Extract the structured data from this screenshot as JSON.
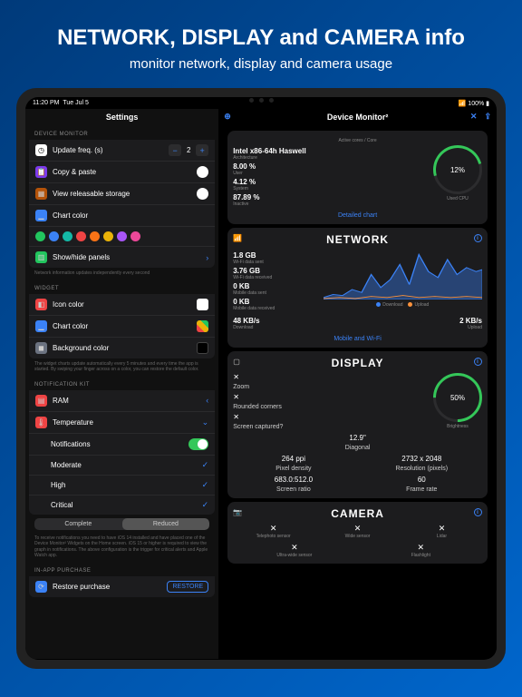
{
  "hero": {
    "title": "NETWORK, DISPLAY and CAMERA info",
    "subtitle": "monitor network, display and camera usage"
  },
  "status": {
    "time": "11:20 PM",
    "date": "Tue Jul 5",
    "battery": "100%"
  },
  "left": {
    "title": "Settings",
    "groups": {
      "device_monitor": "DEVICE MONITOR",
      "widget": "WIDGET",
      "notification_kit": "NOTIFICATION KIT",
      "iap": "IN-APP PURCHASE"
    },
    "rows": {
      "update_freq": "Update freq. (s)",
      "update_val": "2",
      "copy_paste": "Copy & paste",
      "view_storage": "View releasable storage",
      "chart_color": "Chart color",
      "show_hide": "Show/hide panels",
      "icon_color": "Icon color",
      "chart_color2": "Chart color",
      "bg_color": "Background color",
      "ram": "RAM",
      "temperature": "Temperature",
      "notifications": "Notifications",
      "moderate": "Moderate",
      "high": "High",
      "critical": "Critical",
      "complete": "Complete",
      "reduced": "Reduced",
      "restore": "Restore purchase",
      "restore_btn": "RESTORE"
    },
    "caption1": "Network information updates independently every second",
    "caption2": "The widget charts update automatically every 5 minutes and every time the app is started.\nBy swiping your finger across on a color, you can restore the default color.",
    "caption3": "To receive notifications you need to have iOS 14 installed and have placed one of the Device Monitor² Widgets on the Home screen.\niOS 15 or higher is required to view the graph in notifications.\nThe above configuration is the trigger for critical alerts and Apple Watch app."
  },
  "right": {
    "title": "Device Monitor²",
    "cpu": {
      "cores": "Active cores / Core",
      "chip": "Intel x86-64h Haswell",
      "chip_l": "Architecture",
      "user": "8.00 %",
      "user_l": "User",
      "system": "4.12 %",
      "system_l": "System",
      "inactive": "87.89 %",
      "inactive_l": "Inactive",
      "used": "12%",
      "used_l": "Used CPU",
      "link": "Detailed chart"
    },
    "network": {
      "title": "NETWORK",
      "sent": "1.8 GB",
      "sent_l": "Wi-Fi data sent",
      "recv": "3.76 GB",
      "recv_l": "Wi-Fi data received",
      "msent": "0 KB",
      "msent_l": "Mobile data sent",
      "mrecv": "0 KB",
      "mrecv_l": "Mobile data received",
      "down": "48 KB/s",
      "down_l": "Download",
      "up": "2 KB/s",
      "up_l": "Upload",
      "legend_dl": "Download",
      "legend_ul": "Upload",
      "link": "Mobile and Wi-Fi"
    },
    "display": {
      "title": "DISPLAY",
      "zoom": "Zoom",
      "rounded": "Rounded corners",
      "captured": "Screen captured?",
      "diag": "12.9\"",
      "diag_l": "Diagonal",
      "ppi": "264 ppi",
      "ppi_l": "Pixel density",
      "native": "683.0:512.0",
      "native_l": "Screen ratio",
      "bright": "50%",
      "bright_l": "Brightness",
      "res": "2732 x 2048",
      "res_l": "Resolution (pixels)",
      "fps": "60",
      "fps_l": "Frame rate"
    },
    "camera": {
      "title": "CAMERA",
      "tele": "Telephoto sensor",
      "wide": "Wide sensor",
      "lidar": "Lidar",
      "uwide": "Ultra-wide sensor",
      "flash": "Flashlight"
    }
  },
  "chart_data": {
    "type": "area",
    "title": "Network throughput",
    "series": [
      {
        "name": "Download",
        "color": "#3b82f6",
        "values": [
          5,
          8,
          6,
          12,
          9,
          30,
          14,
          25,
          45,
          20,
          60,
          35,
          28,
          55,
          30,
          40
        ]
      },
      {
        "name": "Upload",
        "color": "#fb923c",
        "values": [
          1,
          2,
          1,
          2,
          1,
          3,
          2,
          2,
          4,
          2,
          3,
          2,
          2,
          3,
          2,
          2
        ]
      }
    ],
    "ylabel": "KB/s",
    "ylim": [
      0,
      60
    ]
  }
}
